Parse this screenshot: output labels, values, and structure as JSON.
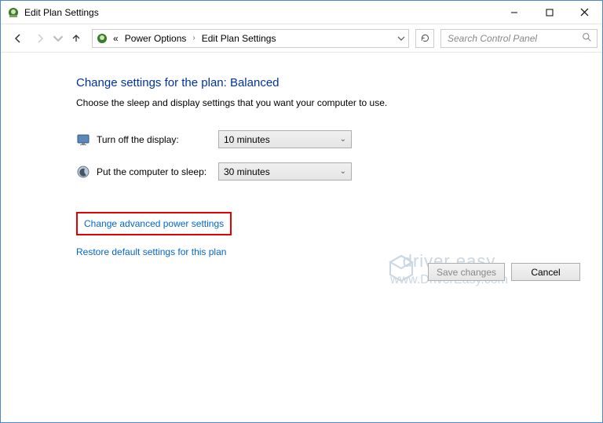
{
  "window": {
    "title": "Edit Plan Settings"
  },
  "breadcrumb": {
    "sep1": "«",
    "seg1": "Power Options",
    "seg2": "Edit Plan Settings"
  },
  "search": {
    "placeholder": "Search Control Panel"
  },
  "main": {
    "heading": "Change settings for the plan: Balanced",
    "sub": "Choose the sleep and display settings that you want your computer to use.",
    "display_label": "Turn off the display:",
    "display_value": "10 minutes",
    "sleep_label": "Put the computer to sleep:",
    "sleep_value": "30 minutes",
    "adv_link": "Change advanced power settings",
    "restore_link": "Restore default settings for this plan"
  },
  "buttons": {
    "save": "Save changes",
    "cancel": "Cancel"
  },
  "watermark": {
    "line1": "driver easy",
    "line2": "www.DriverEasy.com"
  }
}
